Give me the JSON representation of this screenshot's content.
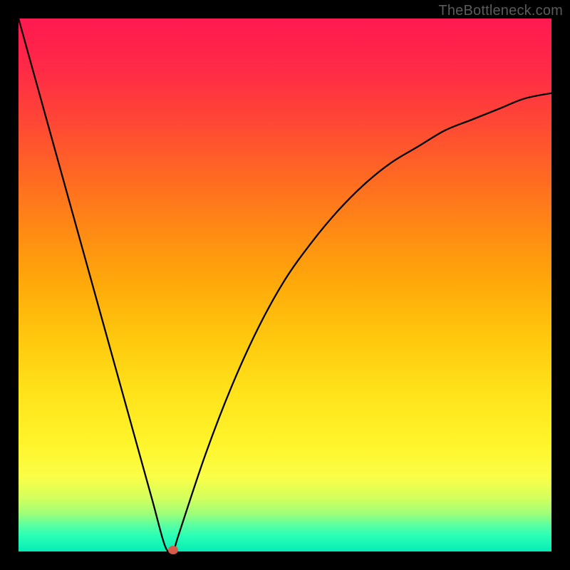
{
  "attribution": "TheBottleneck.com",
  "colors": {
    "gradient_top": "#ff1950",
    "gradient_bottom": "#06ecb5",
    "curve": "#000000",
    "marker": "#d85a4a",
    "frame": "#000000"
  },
  "chart_data": {
    "type": "line",
    "title": "",
    "xlabel": "",
    "ylabel": "",
    "xlim": [
      0,
      100
    ],
    "ylim": [
      0,
      100
    ],
    "grid": false,
    "legend": false,
    "series": [
      {
        "name": "bottleneck-curve",
        "x": [
          0,
          5,
          10,
          15,
          20,
          25,
          27.5,
          29,
          30,
          35,
          40,
          45,
          50,
          55,
          60,
          65,
          70,
          75,
          80,
          85,
          90,
          95,
          100
        ],
        "y": [
          100,
          82,
          64,
          46,
          28,
          10,
          1,
          0,
          3,
          18,
          31,
          42,
          51,
          58,
          64,
          69,
          73,
          76,
          79,
          81,
          83,
          85,
          86
        ]
      }
    ],
    "annotations": [
      {
        "type": "marker",
        "x": 29,
        "y": 0,
        "label": ""
      }
    ]
  }
}
